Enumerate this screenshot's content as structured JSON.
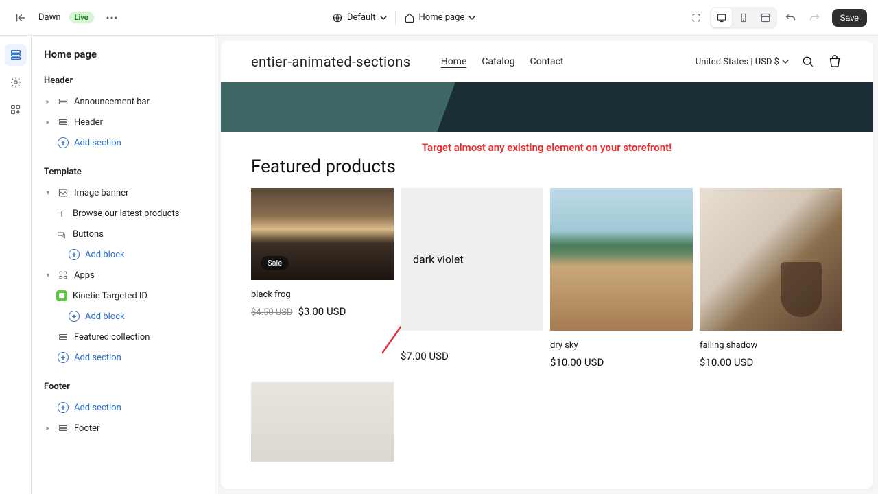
{
  "topbar": {
    "theme_name": "Dawn",
    "live_label": "Live",
    "default_label": "Default",
    "page_label": "Home page",
    "save_label": "Save"
  },
  "sidebar": {
    "title": "Home page",
    "groups": {
      "header": {
        "label": "Header",
        "items": [
          "Announcement bar",
          "Header"
        ],
        "add": "Add section"
      },
      "template": {
        "label": "Template",
        "image_banner": {
          "label": "Image banner",
          "children": [
            "Browse our latest products",
            "Buttons"
          ],
          "add": "Add block"
        },
        "apps": {
          "label": "Apps",
          "children": [
            "Kinetic Targeted ID"
          ],
          "add": "Add block"
        },
        "featured": "Featured collection",
        "add": "Add section"
      },
      "footer": {
        "label": "Footer",
        "add": "Add section",
        "items": [
          "Footer"
        ]
      }
    }
  },
  "store": {
    "logo": "entier-animated-sections",
    "nav": [
      "Home",
      "Catalog",
      "Contact"
    ],
    "region": "United States | USD $"
  },
  "annotation": "Target almost any existing element on your storefront!",
  "featured": {
    "title": "Featured products",
    "products": [
      {
        "name": "black frog",
        "price": "$3.00 USD",
        "old_price": "$4.50 USD",
        "sale": "Sale"
      },
      {
        "name": "dark violet",
        "price": "$7.00 USD"
      },
      {
        "name": "dry sky",
        "price": "$10.00 USD"
      },
      {
        "name": "falling shadow",
        "price": "$10.00 USD"
      }
    ]
  }
}
